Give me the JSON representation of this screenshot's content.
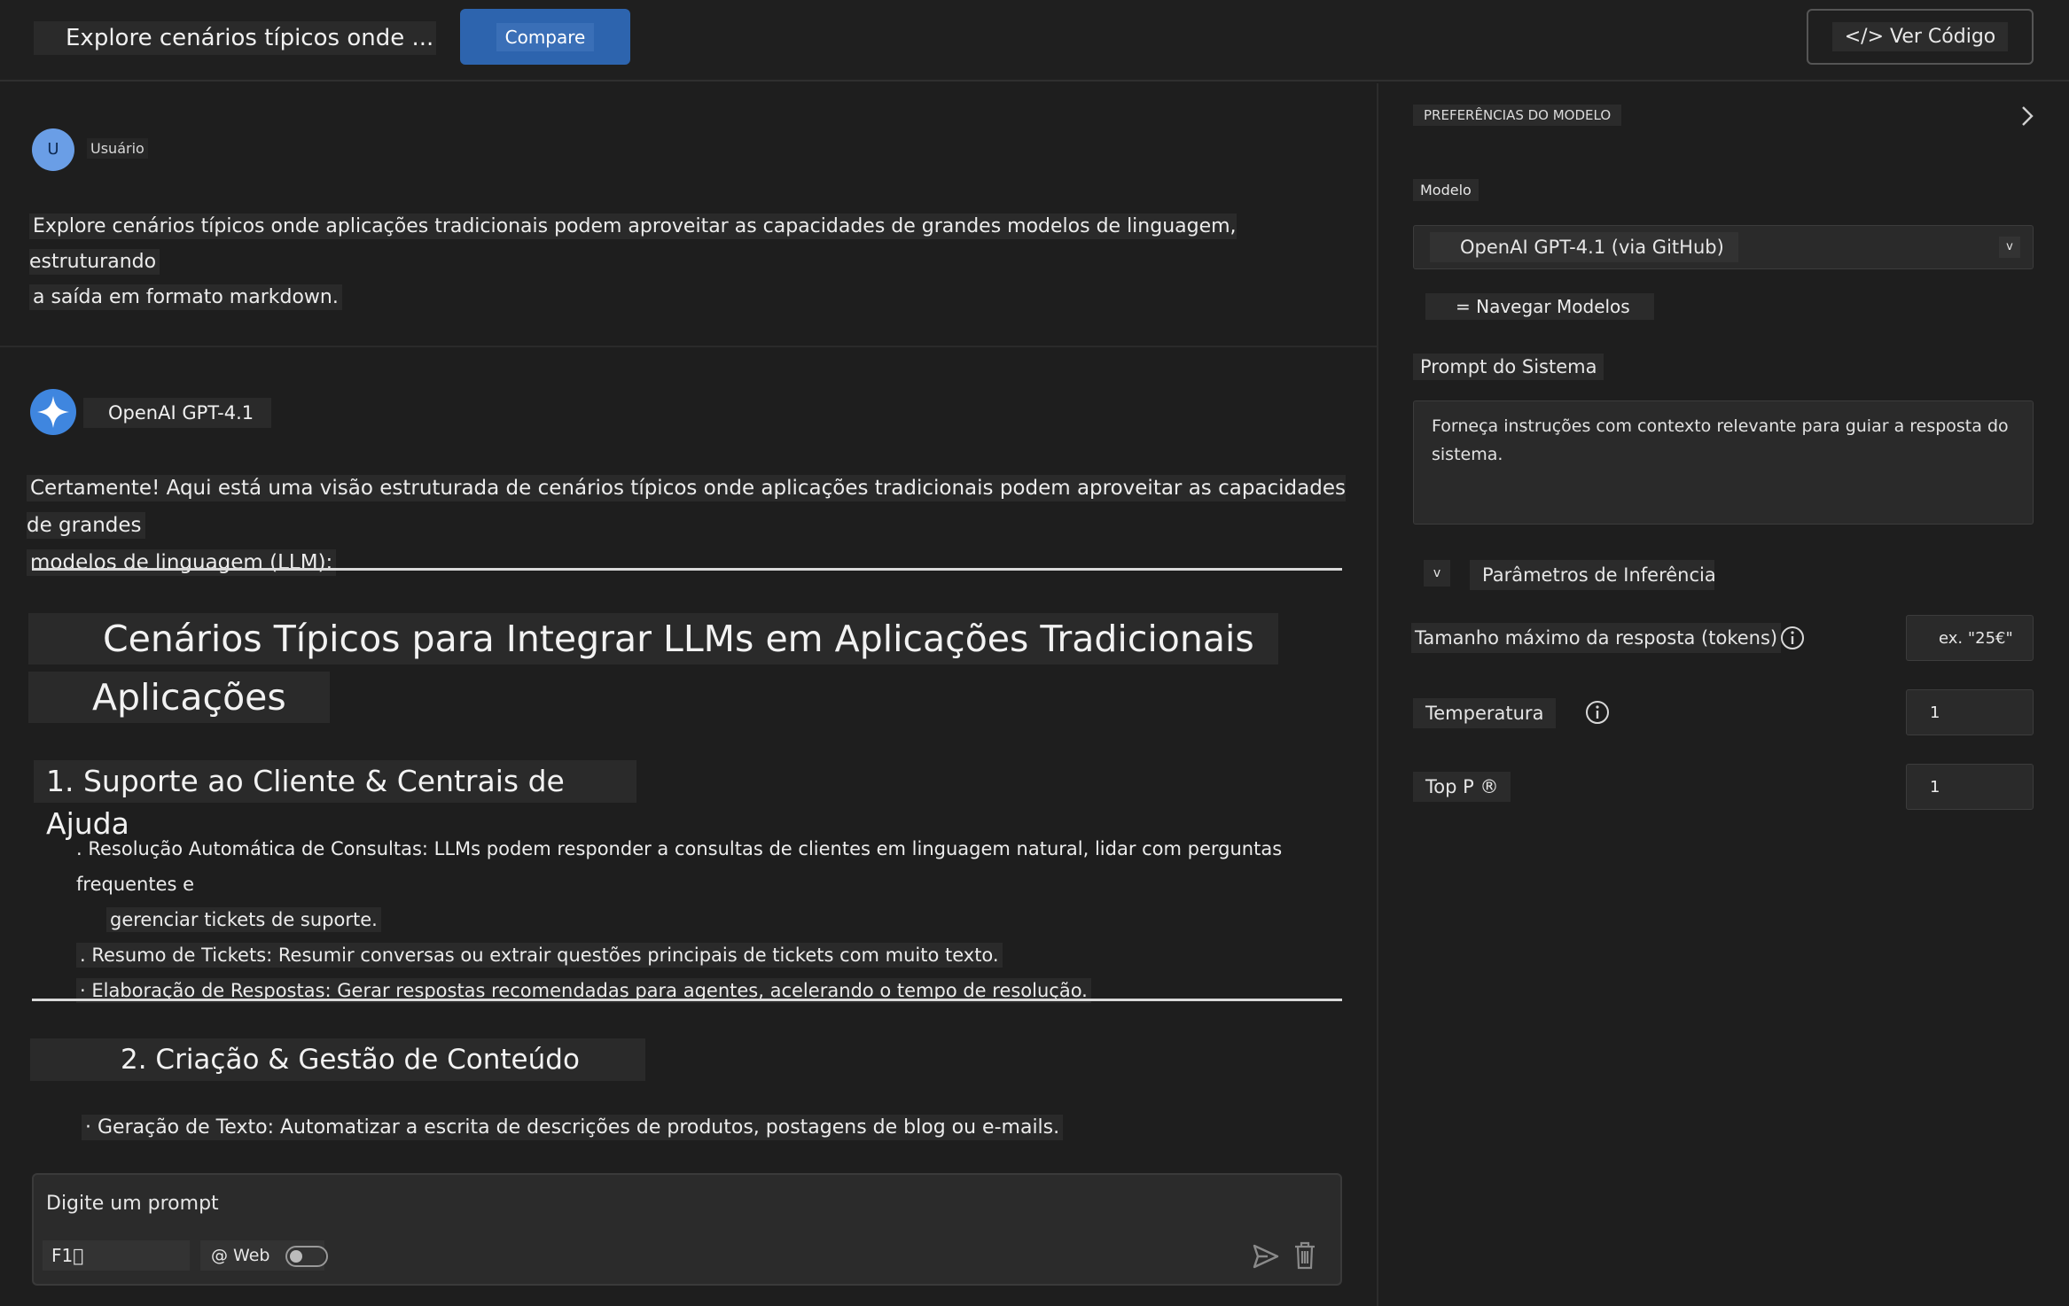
{
  "header": {
    "title": "Explore cenários típicos onde ...",
    "compare_label": "Compare",
    "code_label": "</> Ver Código"
  },
  "chat": {
    "user": {
      "avatar_letter": "U",
      "name": "Usuário",
      "message_line1": "Explore cenários típicos onde aplicações tradicionais podem aproveitar as capacidades de grandes modelos de linguagem, estruturando",
      "message_line2": "a saída em formato markdown."
    },
    "assistant": {
      "name": "OpenAI GPT-4.1",
      "intro_line1": "Certamente! Aqui está uma visão estruturada de cenários típicos onde aplicações tradicionais podem aproveitar as capacidades de grandes",
      "intro_line2": "modelos de linguagem (LLM):",
      "heading_line1": "Cenários Típicos para Integrar LLMs em Aplicações Tradicionais",
      "heading_line2": "Aplicações",
      "section1": {
        "title": "1. Suporte ao Cliente & Centrais de Ajuda",
        "bullet1_line1": ". Resolução Automática de Consultas: LLMs podem responder a consultas de clientes em linguagem natural, lidar com perguntas frequentes e",
        "bullet1_line2": "gerenciar tickets de suporte.",
        "bullet2": ". Resumo de Tickets: Resumir conversas ou extrair questões principais de tickets com muito texto.",
        "bullet3": "· Elaboração de Respostas: Gerar respostas recomendadas para agentes, acelerando o tempo de resolução."
      },
      "section2": {
        "title": "2. Criação & Gestão de Conteúdo",
        "bullet1": "· Geração de Texto: Automatizar a escrita de descrições de produtos, postagens de blog ou e-mails."
      }
    }
  },
  "prompt": {
    "placeholder": "Digite um prompt",
    "tag": "F1⃣",
    "web_label": "@ Web",
    "web_enabled": false
  },
  "settings": {
    "panel_title": "PREFERÊNCIAS DO MODELO",
    "model_label": "Modelo",
    "model_value": "OpenAI GPT-4.1 (via GitHub)",
    "model_caret": "v",
    "browse_label": "= Navegar Modelos",
    "system_prompt_label": "Prompt do Sistema",
    "system_prompt_placeholder": "Forneça instruções com contexto relevante para guiar a resposta do sistema.",
    "inference_toggle": "v",
    "inference_label": "Parâmetros de Inferência",
    "max_tokens_label": "Tamanho máximo da resposta (tokens)",
    "max_tokens_placeholder": "ex. \"25€\"",
    "temperature_label": "Temperatura",
    "temperature_value": "1",
    "top_p_label": "Top P ®",
    "top_p_value": "1"
  },
  "colors": {
    "background": "#1e1e1e",
    "accent": "#2d64ae",
    "assistant_avatar": "#3f86df",
    "user_avatar": "#6a9ee6"
  }
}
